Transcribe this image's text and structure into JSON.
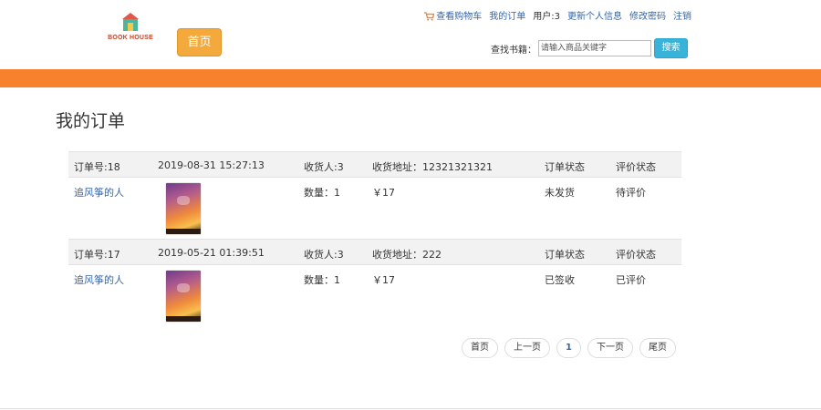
{
  "header": {
    "logo_text": "BOOK HOUSE",
    "home_label": "首页",
    "links": {
      "cart": "查看购物车",
      "orders": "我的订单",
      "user": "用户:3",
      "update_info": "更新个人信息",
      "change_password": "修改密码",
      "logout": "注销"
    },
    "search": {
      "label": "查找书籍：",
      "placeholder": "请输入商品关键字",
      "button": "搜索"
    }
  },
  "page": {
    "title": "我的订单"
  },
  "orders": [
    {
      "order_no": "订单号:18",
      "time": "2019-08-31 15:27:13",
      "receiver": "收货人:3",
      "address": "收货地址：12321321321",
      "status_header": "订单状态",
      "review_header": "评价状态",
      "book_title": "追风筝的人",
      "quantity": "数量：1",
      "price": "￥17",
      "status": "未发货",
      "review": "待评价"
    },
    {
      "order_no": "订单号:17",
      "time": "2019-05-21 01:39:51",
      "receiver": "收货人:3",
      "address": "收货地址：222",
      "status_header": "订单状态",
      "review_header": "评价状态",
      "book_title": "追风筝的人",
      "quantity": "数量：1",
      "price": "￥17",
      "status": "已签收",
      "review": "已评价"
    }
  ],
  "pagination": {
    "first": "首页",
    "prev": "上一页",
    "current": "1",
    "next": "下一页",
    "last": "尾页"
  },
  "colors": {
    "accent_orange": "#f7812c",
    "home_button": "#f3a93b",
    "search_button": "#39b3d7",
    "link": "#3366aa"
  }
}
